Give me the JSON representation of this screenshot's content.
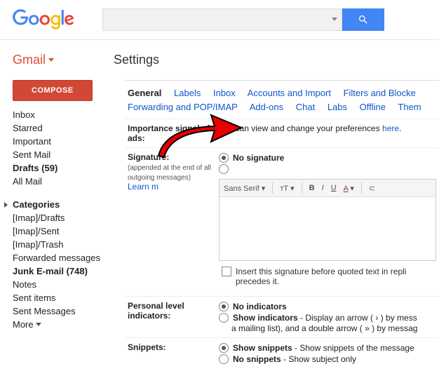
{
  "header": {
    "gmail_brand": "Gmail",
    "settings_title": "Settings"
  },
  "sidebar": {
    "compose": "COMPOSE",
    "items": [
      "Inbox",
      "Starred",
      "Important",
      "Sent Mail",
      "Drafts (59)",
      "All Mail"
    ],
    "categories_label": "Categories",
    "cat_items": [
      "[Imap]/Drafts",
      "[Imap]/Sent",
      "[Imap]/Trash",
      "Forwarded messages",
      "Junk E-mail (748)",
      "Notes",
      "Sent items",
      "Sent Messages"
    ],
    "more": "More"
  },
  "tabs": {
    "row1": [
      "General",
      "Labels",
      "Inbox",
      "Accounts and Import",
      "Filters and Blocke"
    ],
    "row2": [
      "Forwarding and POP/IMAP",
      "Add-ons",
      "Chat",
      "Labs",
      "Offline",
      "Them"
    ]
  },
  "importance": {
    "label": "Importance signals for ads:",
    "text_prefix": "You can view and change your preferences ",
    "link": "here"
  },
  "signature": {
    "label": "Signature:",
    "sub": "(appended at the end of all outgoing messages)",
    "learn": "Learn m",
    "no_sig": "No signature",
    "font": "Sans Serif",
    "insert_before": "Insert this signature before quoted text in repli",
    "precedes": "precedes it."
  },
  "personal": {
    "label": "Personal level indicators:",
    "no_ind": "No indicators",
    "show_ind": "Show indicators",
    "show_desc": " - Display an arrow ( › ) by mess",
    "show_desc2": "a mailing list), and a double arrow ( » ) by messag"
  },
  "snippets": {
    "label": "Snippets:",
    "show": "Show snippets",
    "show_desc": " - Show snippets of the message ",
    "no": "No snippets",
    "no_desc": " - Show subject only"
  }
}
